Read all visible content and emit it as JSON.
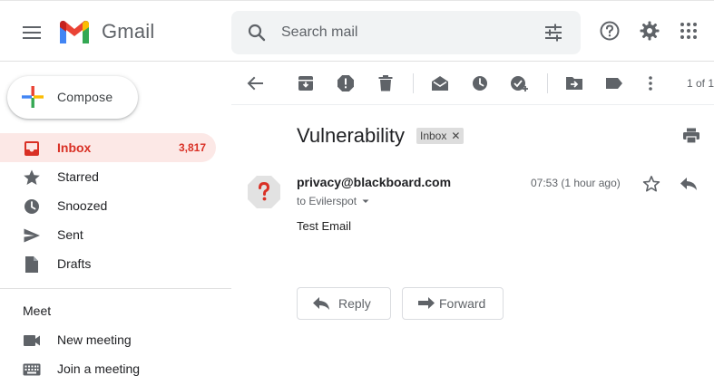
{
  "header": {
    "app_name": "Gmail",
    "search_placeholder": "Search mail"
  },
  "sidebar": {
    "compose_label": "Compose",
    "items": [
      {
        "label": "Inbox",
        "count": "3,817",
        "icon": "inbox-icon",
        "active": true
      },
      {
        "label": "Starred",
        "icon": "star-icon"
      },
      {
        "label": "Snoozed",
        "icon": "clock-icon"
      },
      {
        "label": "Sent",
        "icon": "send-icon"
      },
      {
        "label": "Drafts",
        "icon": "draft-icon"
      }
    ],
    "meet": {
      "heading": "Meet",
      "items": [
        {
          "label": "New meeting",
          "icon": "video-camera-icon"
        },
        {
          "label": "Join a meeting",
          "icon": "keyboard-icon"
        }
      ]
    }
  },
  "toolbar": {
    "pager": "1 of 1"
  },
  "email": {
    "subject": "Vulnerability",
    "label": "Inbox",
    "sender": "privacy@blackboard.com",
    "recipient": "to Evilerspot",
    "timestamp": "07:53 (1 hour ago)",
    "body": "Test Email"
  },
  "actions": {
    "reply_label": "Reply",
    "forward_label": "Forward"
  },
  "colors": {
    "accent_red": "#d93025",
    "active_bg": "#fce8e6",
    "icon_grey": "#5f6368"
  }
}
